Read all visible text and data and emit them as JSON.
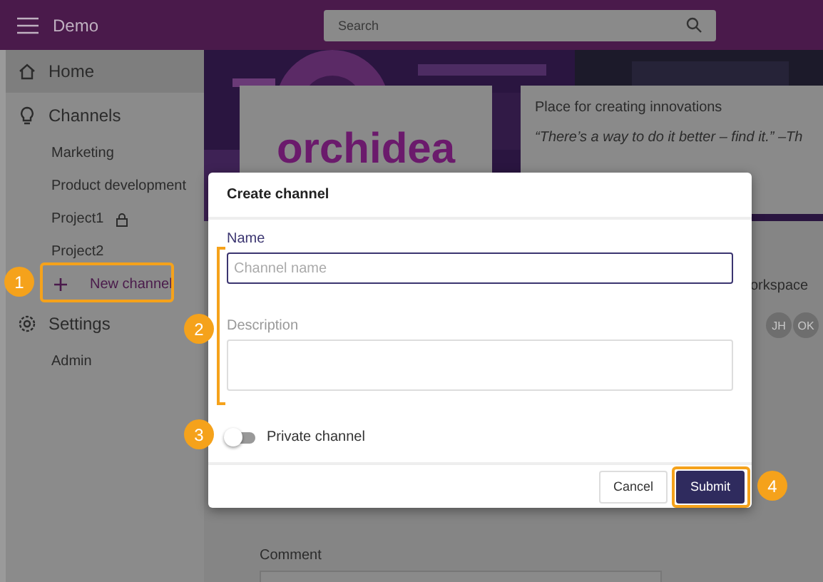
{
  "app_bar": {
    "title": "Demo",
    "search": {
      "placeholder": "Search"
    }
  },
  "sidebar": {
    "items": [
      {
        "kind": "section",
        "label": "Home",
        "selected": true
      },
      {
        "kind": "section",
        "label": "Channels",
        "selected": false
      },
      {
        "kind": "channel",
        "label": "Marketing",
        "locked": false,
        "selected": false
      },
      {
        "kind": "channel",
        "label": "Product development",
        "locked": false,
        "selected": false
      },
      {
        "kind": "channel",
        "label": "Project1",
        "locked": true,
        "selected": false
      },
      {
        "kind": "channel",
        "label": "Project2",
        "locked": false,
        "selected": false
      },
      {
        "kind": "add",
        "label": "New channel",
        "selected": false
      },
      {
        "kind": "section",
        "label": "Settings",
        "selected": false
      },
      {
        "kind": "channel",
        "label": "Admin",
        "locked": false,
        "selected": false
      }
    ]
  },
  "main": {
    "logo": "orchidea",
    "description": "Place for creating innovations",
    "quote": "“There’s a way to do it better – find it.” –Th",
    "workspace": {
      "label": "orkspace",
      "avatars": [
        "JH",
        "OK"
      ]
    },
    "comment": {
      "label": "Comment"
    }
  },
  "dialog": {
    "title": "Create channel",
    "fields": [
      {
        "kind": "input",
        "label": "Name",
        "placeholder": "Channel name",
        "focused": true
      },
      {
        "kind": "textarea",
        "label": "Description",
        "focused": false
      }
    ],
    "toggle": {
      "label": "Private channel",
      "on": false
    },
    "buttons": [
      {
        "label": "Cancel",
        "kind": "secondary"
      },
      {
        "label": "Submit",
        "kind": "primary"
      }
    ]
  },
  "callouts": [
    {
      "number": "1"
    },
    {
      "number": "2"
    },
    {
      "number": "3"
    },
    {
      "number": "4"
    }
  ]
}
